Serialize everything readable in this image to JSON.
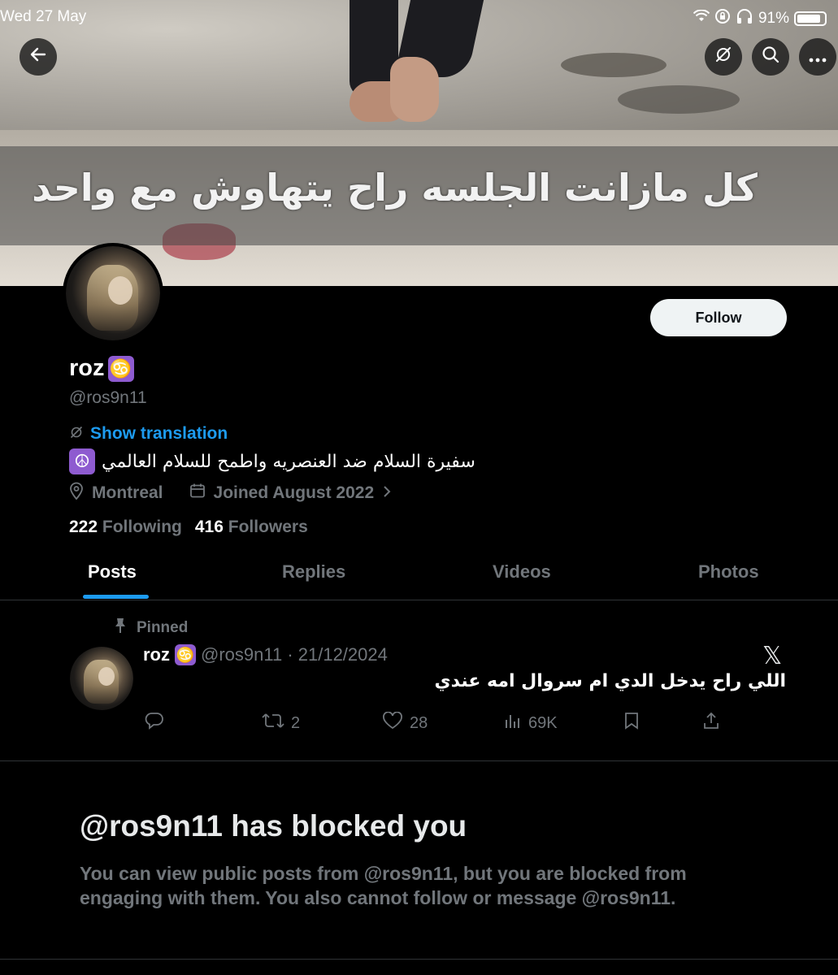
{
  "status_bar": {
    "time": "Wed 27 May",
    "battery": "91%",
    "battery_level": 0.91
  },
  "banner": {
    "caption": "كل مازانت الجلسه راح يتهاوش مع واحد"
  },
  "top_buttons": {
    "back_icon": "arrow-left-icon",
    "translate_icon": "translate-off-icon",
    "search_icon": "search-icon",
    "more_icon": "more-horizontal-icon"
  },
  "profile": {
    "follow_label": "Follow",
    "display_name": "roz",
    "zodiac_glyph": "♋",
    "handle": "@ros9n11",
    "show_translation": "Show translation",
    "bio": "سفيرة السلام ضد العنصريه واطمح للسلام العالمي",
    "bio_emoji": "☮",
    "location": "Montreal",
    "joined": "Joined August 2022",
    "following_count": "222",
    "following_label": "Following",
    "followers_count": "416",
    "followers_label": "Followers"
  },
  "tabs": [
    {
      "label": "Posts"
    },
    {
      "label": "Replies"
    },
    {
      "label": "Videos"
    },
    {
      "label": "Photos"
    }
  ],
  "pinned_post": {
    "pinned_label": "Pinned",
    "name": "roz",
    "zodiac_glyph": "♋",
    "meta": "@ros9n11 · 21/12/2024",
    "x_logo": "𝕏",
    "text": "اللي راح يدخل الدي ام سروال امه عندي",
    "retweets": "2",
    "likes": "28",
    "views": "69K"
  },
  "blocked": {
    "title": "@ros9n11 has blocked you",
    "description": "You can view public posts from @ros9n11, but you are blocked from engaging with them. You also cannot follow or message @ros9n11."
  }
}
